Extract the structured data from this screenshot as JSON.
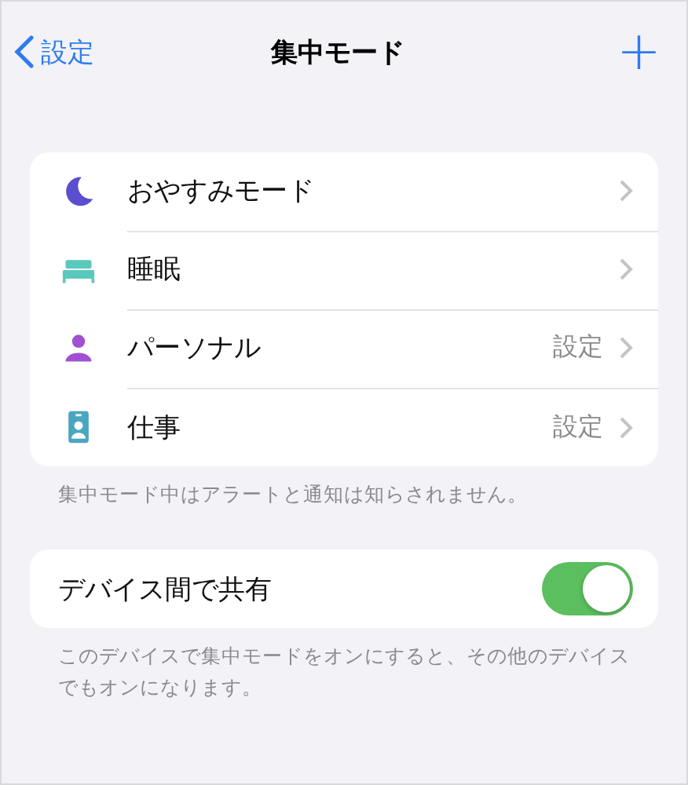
{
  "nav": {
    "back_label": "設定",
    "title": "集中モード",
    "add_label": "+"
  },
  "focus_modes": [
    {
      "kind": "moon",
      "color": "#5a4fcf",
      "label": "おやすみモード"
    },
    {
      "kind": "bed",
      "color": "#5cc8bd",
      "label": "睡眠"
    },
    {
      "kind": "person",
      "color": "#a050d0",
      "label": "パーソナル",
      "detail": "設定"
    },
    {
      "kind": "badge",
      "color": "#4aa6c0",
      "label": "仕事",
      "detail": "設定"
    }
  ],
  "modes_footer": "集中モード中はアラートと通知は知らされません。",
  "share": {
    "label": "デバイス間で共有",
    "on": true
  },
  "share_footer": "このデバイスで集中モードをオンにすると、その他のデバイスでもオンになります。"
}
